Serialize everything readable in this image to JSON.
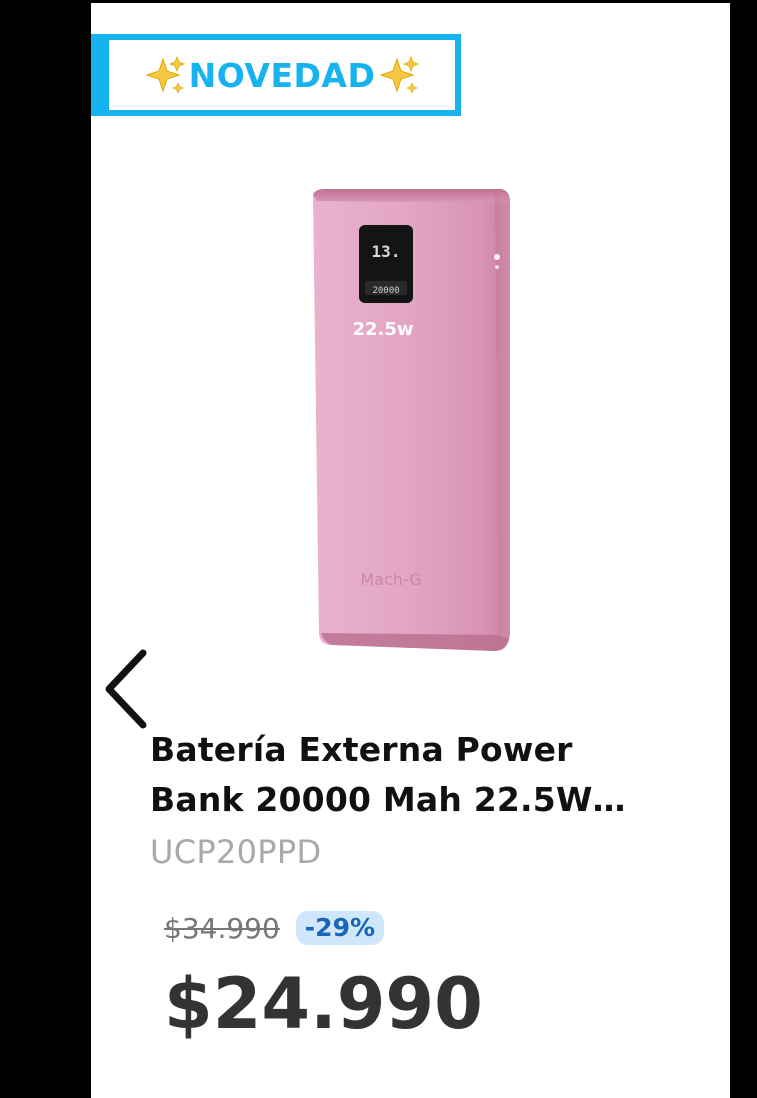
{
  "badge": {
    "label": "NOVEDAD",
    "color": "#17b3f0",
    "left_icon": "sparkles-icon",
    "right_icon": "sparkles-icon"
  },
  "product": {
    "image_icon": "power-bank-image",
    "image_color": "#e8a9c6",
    "title_line1": "Batería Externa Power",
    "title_line2": "Bank 20000 Mah 22.5W…",
    "sku": "UCP20PPD",
    "original_price": "$34.990",
    "discount": "-29%",
    "price": "$24.990"
  },
  "navigation": {
    "prev_icon": "chevron-left-icon"
  }
}
